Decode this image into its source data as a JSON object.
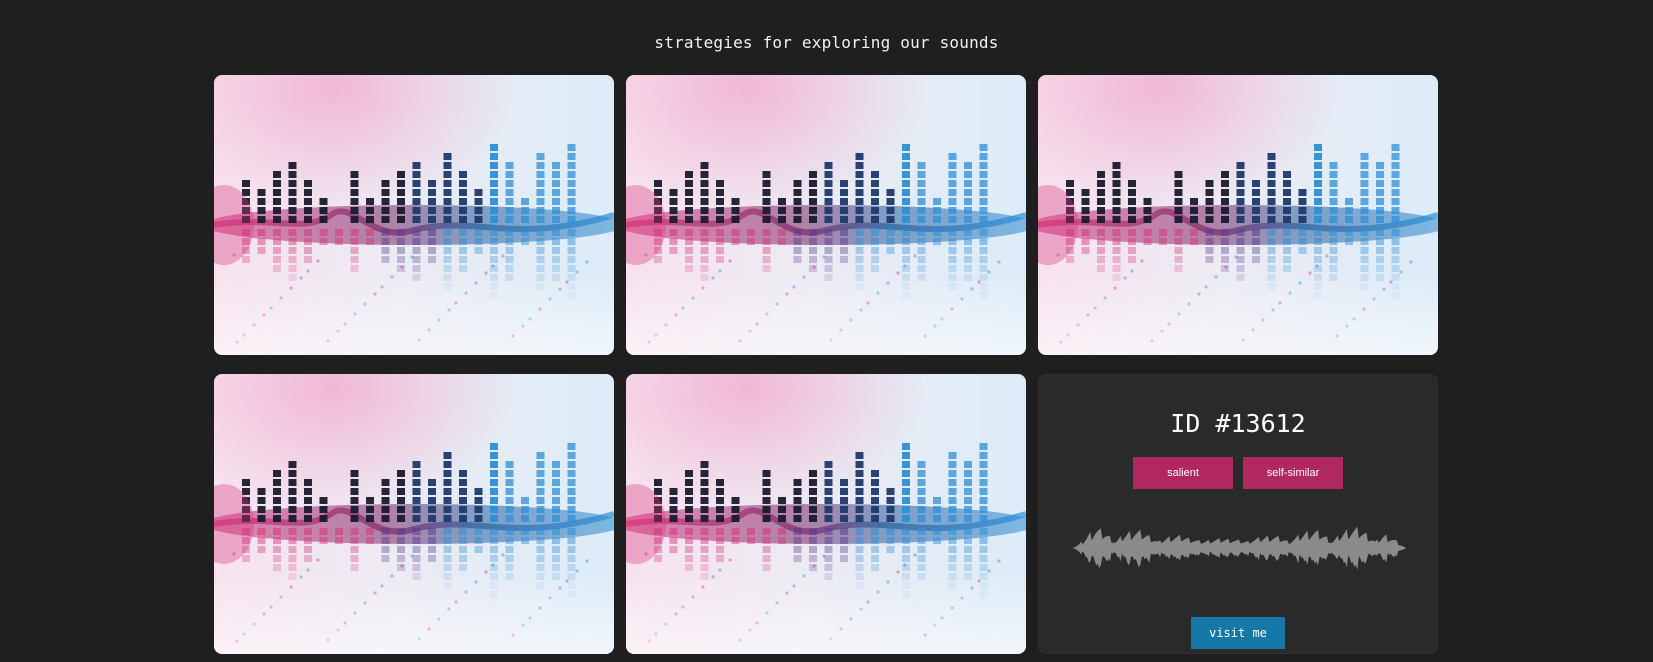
{
  "page": {
    "title": "strategies for exploring our sounds",
    "background": "#1f1f1f"
  },
  "gallery": {
    "image_cards": [
      {
        "icon": "audio-equalizer-image"
      },
      {
        "icon": "audio-equalizer-image"
      },
      {
        "icon": "audio-equalizer-image"
      },
      {
        "icon": "audio-equalizer-image"
      },
      {
        "icon": "audio-equalizer-image"
      }
    ]
  },
  "info_card": {
    "id_label": "ID #13612",
    "tags": [
      "salient",
      "self-similar"
    ],
    "tag_color": "#b0285f",
    "waveform_icon": "audio-waveform",
    "waveform_color": "#8a8a8a",
    "visit_label": "visit me",
    "visit_color": "#1578a6"
  },
  "art_colors": {
    "pink": "#d6357a",
    "blue": "#2e8fd6",
    "dark": "#1a1a2e",
    "bg_light": "#dcecf8"
  }
}
